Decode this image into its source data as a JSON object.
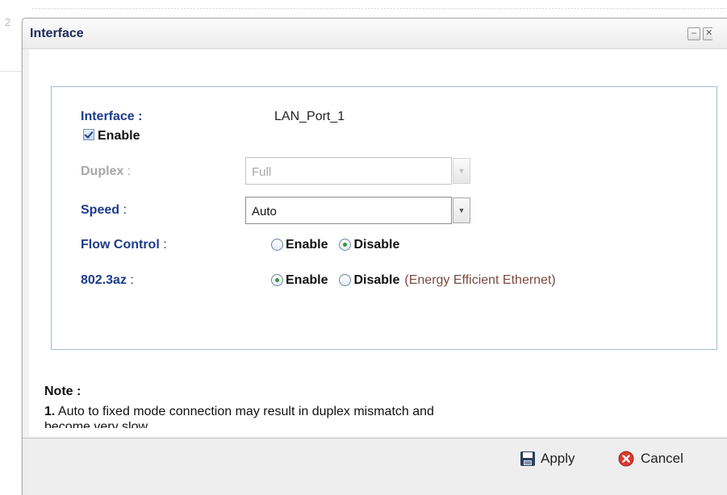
{
  "background": {
    "digit": "2"
  },
  "dialog": {
    "title": "Interface",
    "minimize_icon": "minimize-icon",
    "close_icon": "close-icon"
  },
  "form": {
    "interface_label": "Interface :",
    "interface_value": "LAN_Port_1",
    "enable_checkbox": {
      "label": "Enable",
      "checked": true
    },
    "duplex": {
      "label": "Duplex",
      "colon": ":",
      "value": "Full",
      "disabled": true
    },
    "speed": {
      "label": "Speed",
      "colon": ":",
      "value": "Auto"
    },
    "flow_control": {
      "label": "Flow Control",
      "colon": ":",
      "options": [
        "Enable",
        "Disable"
      ],
      "selected": "Disable"
    },
    "eee": {
      "label": "802.3az",
      "colon": ":",
      "options": [
        "Enable",
        "Disable"
      ],
      "selected": "Enable",
      "hint": "(Energy Efficient Ethernet)"
    }
  },
  "note": {
    "title": "Note :",
    "item_number": "1.",
    "item_text": " Auto to fixed mode connection may result in duplex mismatch and",
    "item_text_cont": "become very slow."
  },
  "footer": {
    "apply_label": "Apply",
    "cancel_label": "Cancel",
    "apply_icon": "save-icon",
    "cancel_icon": "cancel-icon"
  },
  "colors": {
    "label_blue": "#1c3b8a",
    "hint_brown": "#7a4a3e",
    "panel_border": "#a3bcd3",
    "radio_dot": "#2f9a2f",
    "cancel_red": "#d63c2f"
  }
}
